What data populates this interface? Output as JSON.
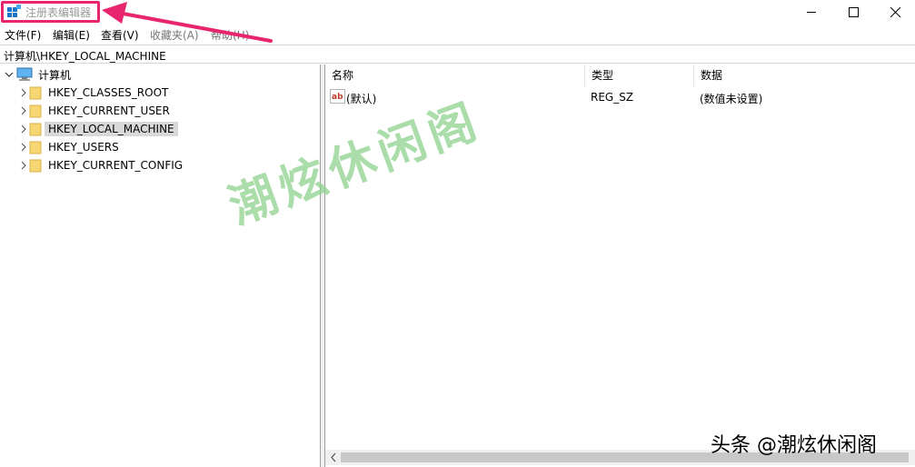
{
  "window": {
    "title": "注册表编辑器",
    "icon": "regedit-icon",
    "accent_highlight": "#e8266d"
  },
  "menu": {
    "items": [
      "文件(F)",
      "编辑(E)",
      "查看(V)",
      "收藏夹(A)",
      "帮助(H)"
    ]
  },
  "address": {
    "path": "计算机\\HKEY_LOCAL_MACHINE"
  },
  "tree": {
    "root": "计算机",
    "children": [
      {
        "label": "HKEY_CLASSES_ROOT",
        "selected": false
      },
      {
        "label": "HKEY_CURRENT_USER",
        "selected": false
      },
      {
        "label": "HKEY_LOCAL_MACHINE",
        "selected": true
      },
      {
        "label": "HKEY_USERS",
        "selected": false
      },
      {
        "label": "HKEY_CURRENT_CONFIG",
        "selected": false
      }
    ]
  },
  "list": {
    "columns": [
      "名称",
      "类型",
      "数据"
    ],
    "rows": [
      {
        "name": "(默认)",
        "type": "REG_SZ",
        "data": "(数值未设置)",
        "icon": "string-value-icon"
      }
    ]
  },
  "overlay": {
    "watermark": "潮炫休闲阁",
    "credit": "头条 @潮炫休闲阁",
    "watermark_color": "#8ed28e"
  }
}
